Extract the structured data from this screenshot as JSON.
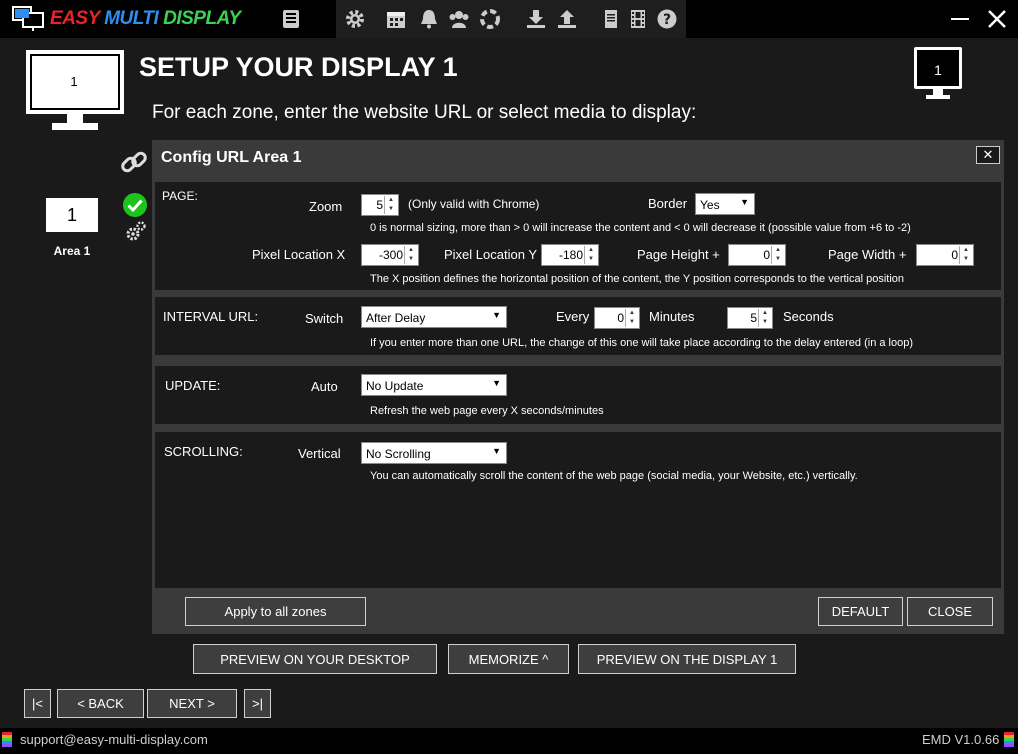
{
  "app": {
    "logo": "EASY MULTI DISPLAY",
    "version": "EMD V1.0.66",
    "support_email": "support@easy-multi-display.com"
  },
  "toolbar_icons": [
    "contact-card-icon",
    "settings-gear-icon",
    "calendar-icon",
    "bell-icon",
    "users-icon",
    "lifebuoy-icon",
    "download-icon",
    "upload-icon",
    "document-icon",
    "film-icon",
    "help-icon"
  ],
  "window": {
    "minimize": "minimize-icon",
    "close": "close-icon"
  },
  "header": {
    "title": "SETUP YOUR DISPLAY 1",
    "subtitle": "For each zone, enter the website URL or select media to display:",
    "display_number": "1"
  },
  "area": {
    "number": "1",
    "label": "Area 1"
  },
  "dialog": {
    "title": "Config URL Area 1",
    "close_label": "✕",
    "page": {
      "section_label": "PAGE:",
      "zoom_label": "Zoom",
      "zoom_value": "5",
      "zoom_note": "(Only valid with Chrome)",
      "border_label": "Border",
      "border_value": "Yes",
      "zoom_hint": "0 is normal sizing, more than > 0 will increase the content and < 0 will decrease it (possible value from +6 to -2)",
      "pixel_x_label": "Pixel Location X",
      "pixel_x_value": "-300",
      "pixel_y_label": "Pixel Location Y",
      "pixel_y_value": "-180",
      "page_height_label": "Page Height +",
      "page_height_value": "0",
      "page_width_label": "Page Width +",
      "page_width_value": "0",
      "position_hint": "The X position defines the horizontal position of the content, the Y position corresponds to the vertical position"
    },
    "interval": {
      "section_label": "INTERVAL URL:",
      "switch_label": "Switch",
      "switch_value": "After Delay",
      "every_label": "Every",
      "minutes_value": "0",
      "minutes_label": "Minutes",
      "seconds_value": "5",
      "seconds_label": "Seconds",
      "hint": "If you enter more than one URL, the change of this one will take place according to the delay entered (in a loop)"
    },
    "update": {
      "section_label": "UPDATE:",
      "auto_label": "Auto",
      "auto_value": "No Update",
      "hint": "Refresh the web page every X seconds/minutes"
    },
    "scrolling": {
      "section_label": "SCROLLING:",
      "vertical_label": "Vertical",
      "vertical_value": "No Scrolling",
      "hint": "You can automatically scroll the content of the web page (social media, your Website, etc.) vertically."
    },
    "apply_all": "Apply to all zones",
    "default": "DEFAULT",
    "close": "CLOSE"
  },
  "actions": {
    "preview_desktop": "PREVIEW ON YOUR DESKTOP",
    "memorize": "MEMORIZE ^",
    "preview_display": "PREVIEW ON THE DISPLAY 1"
  },
  "nav": {
    "first": "|<",
    "back": "< BACK",
    "next": "NEXT >",
    "last": ">|"
  },
  "colors": {
    "background": "#1a1a1a",
    "panel": "#3a3a3a",
    "accent_green": "#1ec41e",
    "logo_red": "#e8232a",
    "logo_blue": "#2f8ef0",
    "logo_green": "#39d353"
  }
}
